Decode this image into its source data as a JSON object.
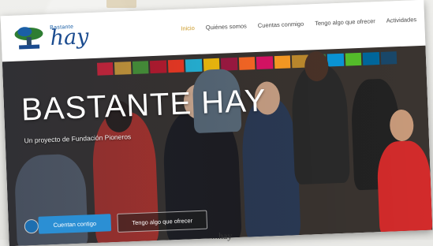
{
  "brand": {
    "small": "Bastante",
    "big": "hay"
  },
  "nav": {
    "items": [
      "Inicio",
      "Quiénes somos",
      "Cuentas conmigo",
      "Tengo algo que ofrecer",
      "Actividades"
    ]
  },
  "hero": {
    "title": "BASTANTE HAY",
    "subtitle": "Un proyecto de Fundación Pioneros",
    "primary_button": "Cuentan contigo",
    "secondary_button": "Tengo algo que ofrecer"
  },
  "caption": "...hay",
  "colors": {
    "accent": "#2b8fd4",
    "logo": "#1a4b8f",
    "nav_active": "#cc9a27"
  },
  "sdg_colors": [
    "#e5243b",
    "#dda63a",
    "#4c9f38",
    "#c5192d",
    "#ff3a21",
    "#26bde2",
    "#fcc30b",
    "#a21942",
    "#fd6925",
    "#dd1367",
    "#fd9d24",
    "#bf8b2e",
    "#3f7e44",
    "#0a97d9",
    "#56c02b",
    "#00689d",
    "#19486a"
  ]
}
